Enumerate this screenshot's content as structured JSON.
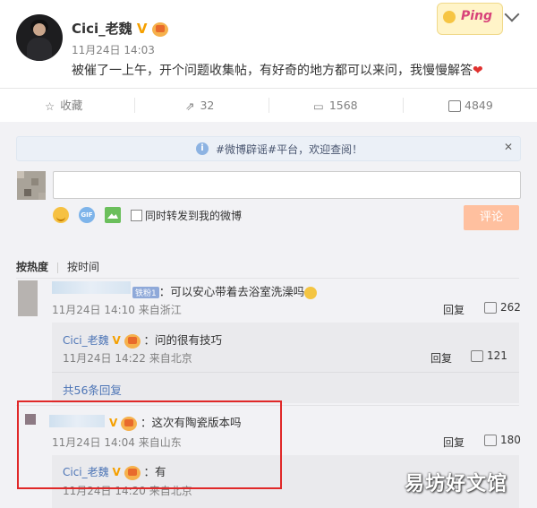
{
  "post": {
    "username": "Cici_老魏",
    "v_badge": "V",
    "timestamp": "11月24日 14:03",
    "content": "被催了一上午，开个问题收集帖，有好奇的地方都可以来问，我慢慢解答",
    "sticker_text": "Ping"
  },
  "actions": {
    "favorite": "收藏",
    "repost_count": "32",
    "comment_count": "1568",
    "like_count": "4849"
  },
  "notice": {
    "text": "#微博辟谣#平台，欢迎查阅！",
    "close": "✕"
  },
  "composer": {
    "forward_label": "同时转发到我的微博",
    "submit_label": "评论",
    "gif_label": "GIF"
  },
  "sort": {
    "by_hot": "按热度",
    "by_time": "按时间"
  },
  "comments": [
    {
      "fans_badge": "铁粉1",
      "text": "：可以安心带着去浴室洗澡吗",
      "meta": "11月24日 14:10 来自浙江",
      "reply_label": "回复",
      "likes": "262",
      "reply": {
        "name": "Cici_老魏",
        "text": "：问的很有技巧",
        "meta": "11月24日 14:22 来自北京",
        "reply_label": "回复",
        "likes": "121"
      },
      "more_replies": "共56条回复"
    },
    {
      "text": "：这次有陶瓷版本吗",
      "meta": "11月24日 14:04 来自山东",
      "reply_label": "回复",
      "likes": "180",
      "reply": {
        "name": "Cici_老魏",
        "text": "：有",
        "meta": "11月24日 14:20 来自北京"
      }
    }
  ],
  "watermark": "易坊好文馆"
}
